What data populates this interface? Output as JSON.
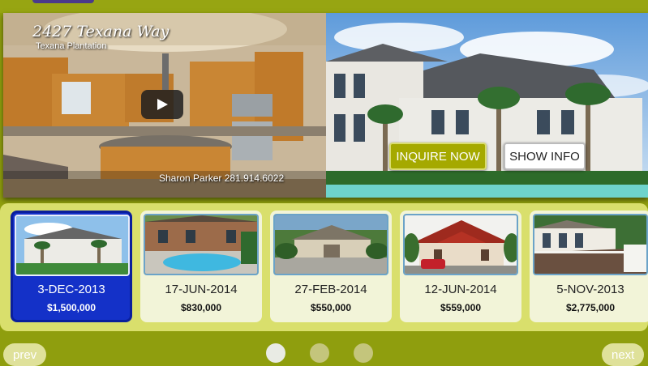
{
  "video": {
    "title": "2427 Texana Way",
    "subtitle": "Texana Plantation",
    "caption": "Sharon Parker  281.914.6022",
    "play_icon": "play-icon"
  },
  "actions": {
    "inquire_label": "INQUIRE NOW",
    "show_info_label": "SHOW INFO"
  },
  "listings": [
    {
      "date": "3-DEC-2013",
      "price": "$1,500,000",
      "active": true
    },
    {
      "date": "17-JUN-2014",
      "price": "$830,000",
      "active": false
    },
    {
      "date": "27-FEB-2014",
      "price": "$550,000",
      "active": false
    },
    {
      "date": "12-JUN-2014",
      "price": "$559,000",
      "active": false
    },
    {
      "date": "5-NOV-2013",
      "price": "$2,775,000",
      "active": false
    }
  ],
  "pager": {
    "prev_label": "prev",
    "next_label": "next",
    "dots": 3,
    "active_dot": 1
  },
  "colors": {
    "background": "#8f9e0e",
    "strip": "#d9df6c",
    "active_card": "#1431c8",
    "inquire_button": "#a5a900"
  }
}
